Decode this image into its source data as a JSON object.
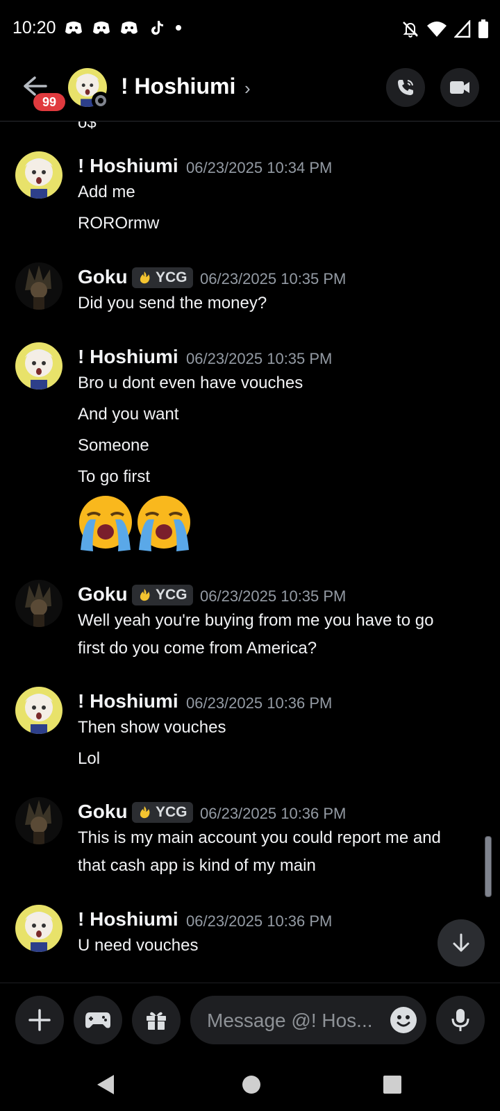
{
  "status_bar": {
    "time": "10:20"
  },
  "header": {
    "unread_badge": "99",
    "title": "! Hoshiumi"
  },
  "messages": [
    {
      "author": "! Hoshiumi",
      "timestamp": "06/23/2025 10:34 PM",
      "lines": [
        "Add me",
        "ROROrmw"
      ]
    },
    {
      "author": "Goku",
      "tag": "YCG",
      "timestamp": "06/23/2025 10:35 PM",
      "lines": [
        "Did you send the money?"
      ]
    },
    {
      "author": "! Hoshiumi",
      "timestamp": "06/23/2025 10:35 PM",
      "lines": [
        "Bro u dont even have vouches",
        "And you want",
        "Someone",
        "To go first"
      ]
    },
    {
      "author": "Goku",
      "tag": "YCG",
      "timestamp": "06/23/2025 10:35 PM",
      "lines": [
        "Well yeah you're buying from me you have to go",
        "first do you come from America?"
      ]
    },
    {
      "author": "! Hoshiumi",
      "timestamp": "06/23/2025 10:36 PM",
      "lines": [
        "Then show vouches",
        "Lol"
      ]
    },
    {
      "author": "Goku",
      "tag": "YCG",
      "timestamp": "06/23/2025 10:36 PM",
      "lines": [
        "This is my main account you could report me and",
        "that cash app is kind of my main"
      ]
    },
    {
      "author": "! Hoshiumi",
      "timestamp": "06/23/2025 10:36 PM",
      "lines": [
        "U need vouches"
      ]
    }
  ],
  "composer": {
    "placeholder": "Message @! Hos..."
  },
  "colors": {
    "background": "#000000",
    "badge": "#e03a3e",
    "surface": "#1e1f22",
    "timestamp": "#949ba4"
  },
  "icons": [
    "back-arrow-icon",
    "phone-icon",
    "video-camera-icon",
    "plus-icon",
    "gamepad-icon",
    "gift-icon",
    "emoji-icon",
    "microphone-icon",
    "arrow-down-icon",
    "fire-icon",
    "loudly-crying-face-emoji"
  ]
}
